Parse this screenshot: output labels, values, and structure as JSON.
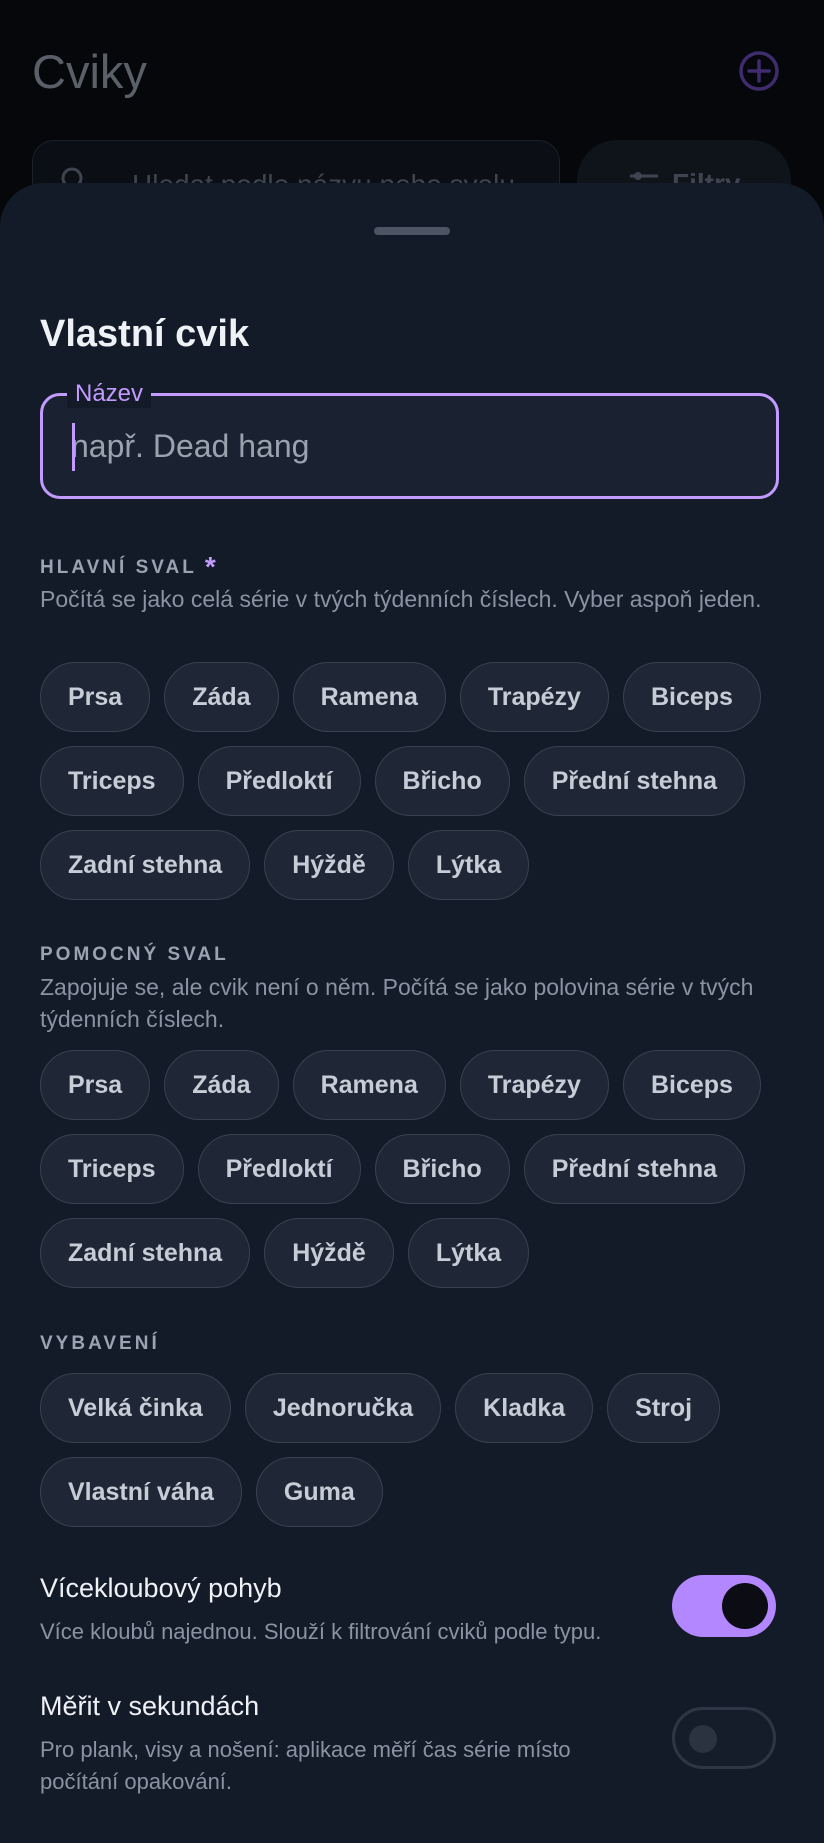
{
  "background": {
    "title": "Cviky",
    "search_placeholder": "Hledat podle názvu nebo svalu",
    "filter_label": "Filtry"
  },
  "sheet": {
    "title": "Vlastní cvik",
    "name_field": {
      "label": "Název",
      "placeholder": "např. Dead hang",
      "value": ""
    },
    "primary_muscle": {
      "heading": "HLAVNÍ SVAL",
      "required_mark": "*",
      "description": "Počítá se jako celá série v tvých týdenních číslech. Vyber aspoň jeden.",
      "options": [
        "Prsa",
        "Záda",
        "Ramena",
        "Trapézy",
        "Biceps",
        "Triceps",
        "Předloktí",
        "Břicho",
        "Přední stehna",
        "Zadní stehna",
        "Hýždě",
        "Lýtka"
      ]
    },
    "secondary_muscle": {
      "heading": "POMOCNÝ SVAL",
      "description": "Zapojuje se, ale cvik není o něm. Počítá se jako polovina série v tvých týdenních číslech.",
      "options": [
        "Prsa",
        "Záda",
        "Ramena",
        "Trapézy",
        "Biceps",
        "Triceps",
        "Předloktí",
        "Břicho",
        "Přední stehna",
        "Zadní stehna",
        "Hýždě",
        "Lýtka"
      ]
    },
    "equipment": {
      "heading": "VYBAVENÍ",
      "options": [
        "Velká činka",
        "Jednoručka",
        "Kladka",
        "Stroj",
        "Vlastní váha",
        "Guma"
      ]
    },
    "compound": {
      "title": "Vícekloubový pohyb",
      "description": "Více kloubů najednou. Slouží k filtrování cviků podle typu.",
      "enabled": true
    },
    "timed": {
      "title": "Měřit v sekundách",
      "description": "Pro plank, visy a nošení: aplikace měří čas série místo počítání opakování.",
      "enabled": false
    }
  },
  "colors": {
    "accent": "#c39bff",
    "toggle_on": "#b387ff",
    "sheet_bg": "#141b28",
    "chip_bg": "#1f2736"
  }
}
